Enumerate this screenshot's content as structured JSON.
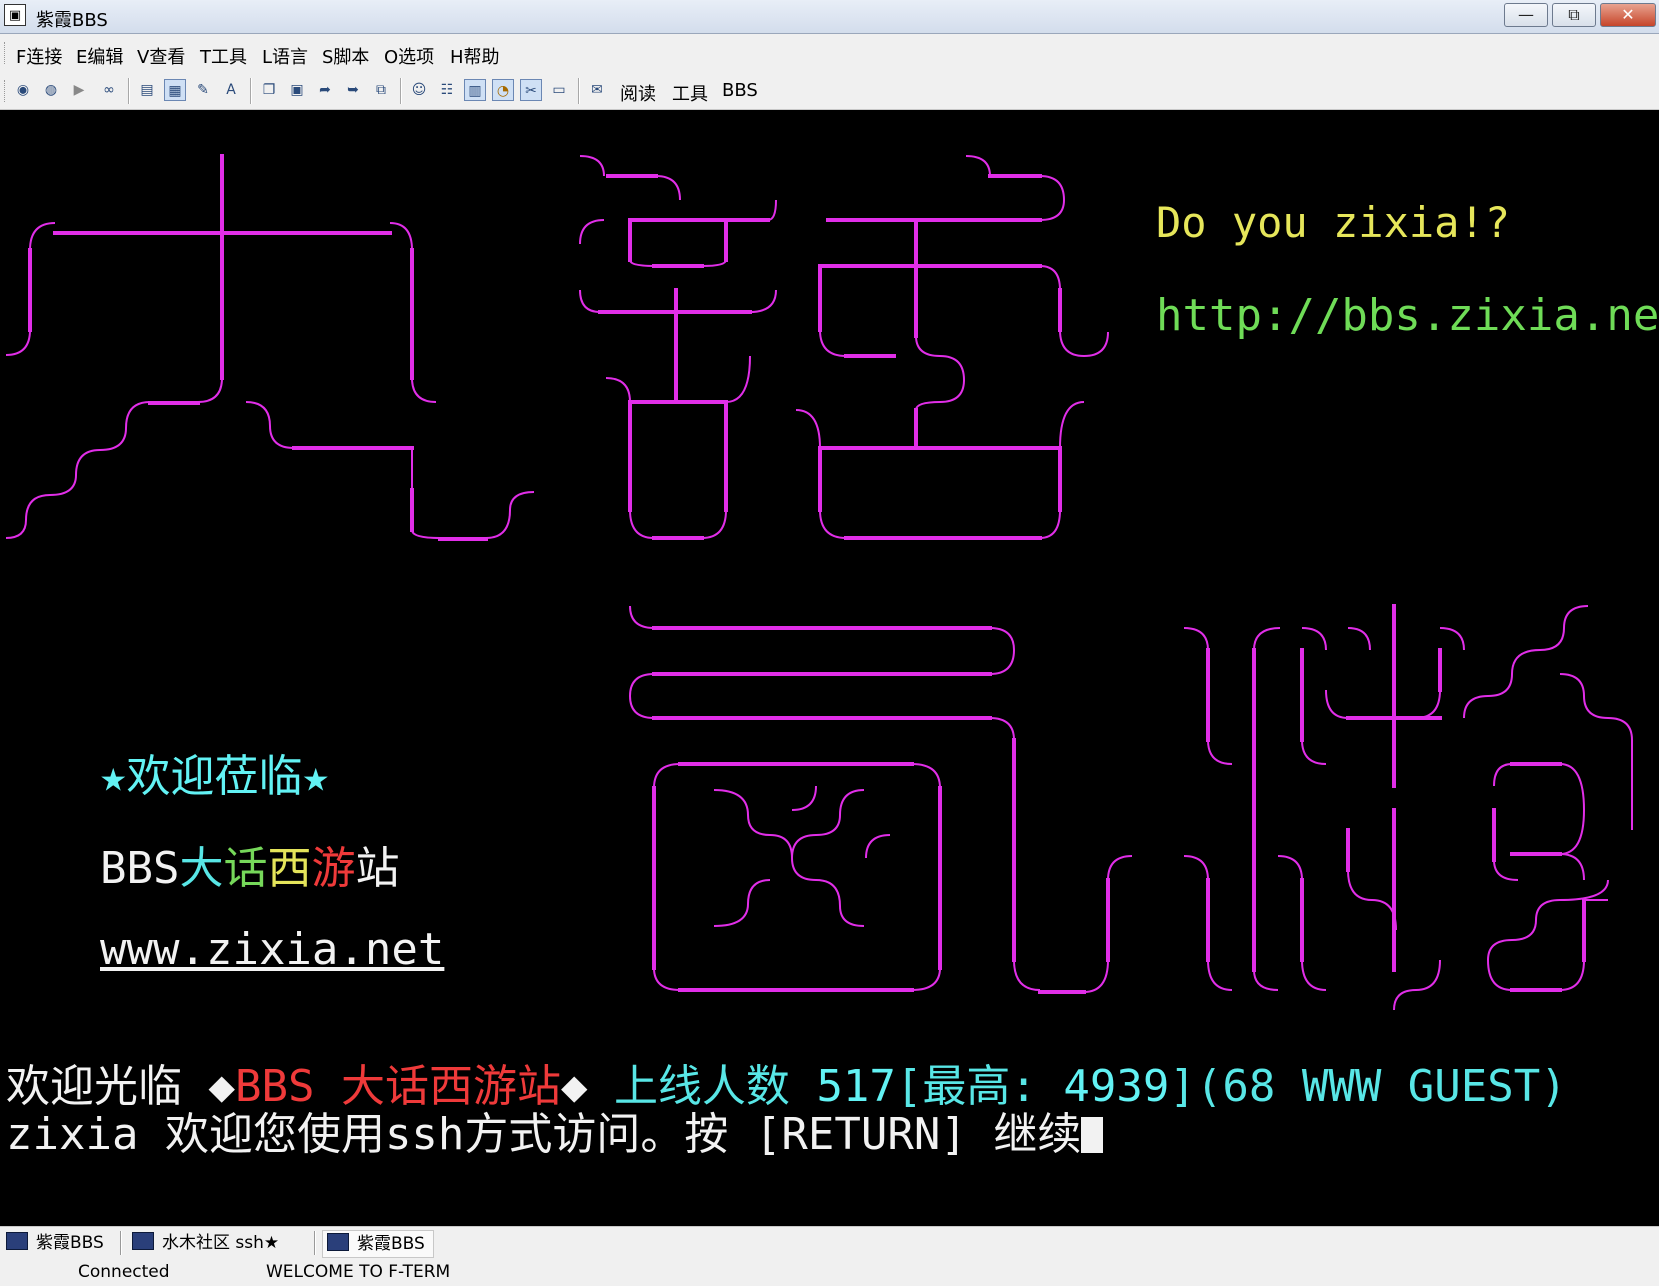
{
  "window": {
    "title": "紫霞BBS",
    "minimize": "—",
    "restore": "⧉",
    "close": "✕"
  },
  "menu": [
    "F连接",
    "E编辑",
    "V查看",
    "T工具",
    "L语言",
    "S脚本",
    "O选项",
    "H帮助"
  ],
  "toolbar": {
    "labels": [
      "阅读",
      "工具",
      "BBS"
    ]
  },
  "terminal": {
    "tagline": "Do you zixia!?",
    "url": "http://bbs.zixia.net",
    "welcome_banner": "★欢迎莅临★",
    "site_prefix": "BBS",
    "site_chars": [
      "大",
      "话",
      "西",
      "游",
      "站"
    ],
    "site_link": "www.zixia.net",
    "line1": {
      "prefix": "欢迎光临 ◆",
      "site": "BBS 大话西游站",
      "mid": "◆ ",
      "online_label": "上线人数 ",
      "online_count": "517",
      "max_label": "[最高: ",
      "max_count": "4939",
      "close_bracket": "]",
      "guests": "(68 WWW GUEST)"
    },
    "line2": "zixia 欢迎您使用ssh方式访问。按 [RETURN] 继续",
    "colors": {
      "art": "#e12ee8",
      "tagline": "#e6e65a",
      "url": "#6fdc57",
      "welcome": "#62f2f4",
      "site_char_colors": [
        "#58e6e6",
        "#76d85a",
        "#e4e45a",
        "#ef3a3a",
        "#f2f2f2"
      ]
    }
  },
  "tabs": [
    "紫霞BBS",
    "水木社区 ssh★",
    "紫霞BBS"
  ],
  "status": {
    "connection": "Connected",
    "message": "WELCOME TO F-TERM"
  }
}
